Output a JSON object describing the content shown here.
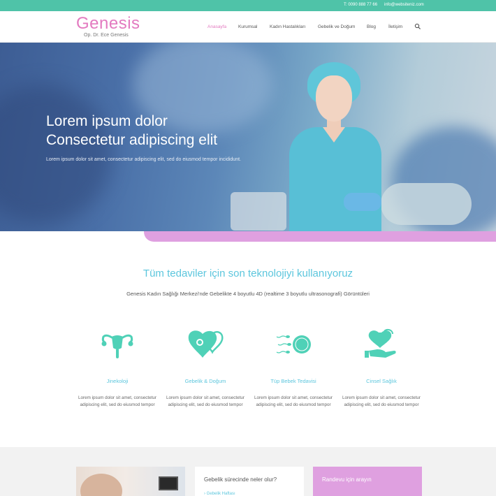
{
  "topbar": {
    "phone": "T: 0090 888 77 66",
    "email": "info@websiteniz.com"
  },
  "header": {
    "logo": "Genesis",
    "logo_subtitle": "Op. Dr. Ece Genesis",
    "nav": [
      {
        "label": "Anasayfa",
        "active": true
      },
      {
        "label": "Kurumsal",
        "active": false
      },
      {
        "label": "Kadın Hastalıkları",
        "active": false
      },
      {
        "label": "Gebelik ve Doğum",
        "active": false
      },
      {
        "label": "Blog",
        "active": false
      },
      {
        "label": "İletişim",
        "active": false
      }
    ],
    "search_icon": "search-icon"
  },
  "hero": {
    "title_line1": "Lorem ipsum dolor",
    "title_line2": "Consectetur adipiscing elit",
    "text": "Lorem ipsum dolor sit amet, consectetur adipiscing elit, sed do eiusmod tempor incididunt."
  },
  "section": {
    "title": "Tüm tedaviler için son teknolojiyi kullanıyoruz",
    "subtitle": "Genesis Kadın Sağlığı Merkezi'nde Gebelikte 4 boyutlu 4D (realtime 3 boyutlu ultrasonografi) Görüntüleri"
  },
  "features": [
    {
      "icon": "uterus-icon",
      "title": "Jinekoloji",
      "text": "Lorem ipsum dolor sit amet, consectetur adipiscing elit, sed do eiusmod tempor"
    },
    {
      "icon": "pregnancy-heart-icon",
      "title": "Gebelik & Doğum",
      "text": "Lorem ipsum dolor sit amet, consectetur adipiscing elit, sed do eiusmod tempor"
    },
    {
      "icon": "ivf-sperm-egg-icon",
      "title": "Tüp Bebek Tedavisi",
      "text": "Lorem ipsum dolor sit amet, consectetur adipiscing elit, sed do eiusmod tempor"
    },
    {
      "icon": "heart-hand-icon",
      "title": "Cinsel Sağlık",
      "text": "Lorem ipsum dolor sit amet, consectetur adipiscing elit, sed do eiusmod tempor"
    }
  ],
  "bottom": {
    "card_title": "Gebelik sürecinde neler olur?",
    "card_link": "› Gebelik Haftası",
    "appointment_title": "Randevu için arayın"
  },
  "colors": {
    "accent_teal": "#4fc3a8",
    "accent_pink": "#e37ac0",
    "title_cyan": "#5cc6dd",
    "pink_band": "#dfa0e0"
  }
}
